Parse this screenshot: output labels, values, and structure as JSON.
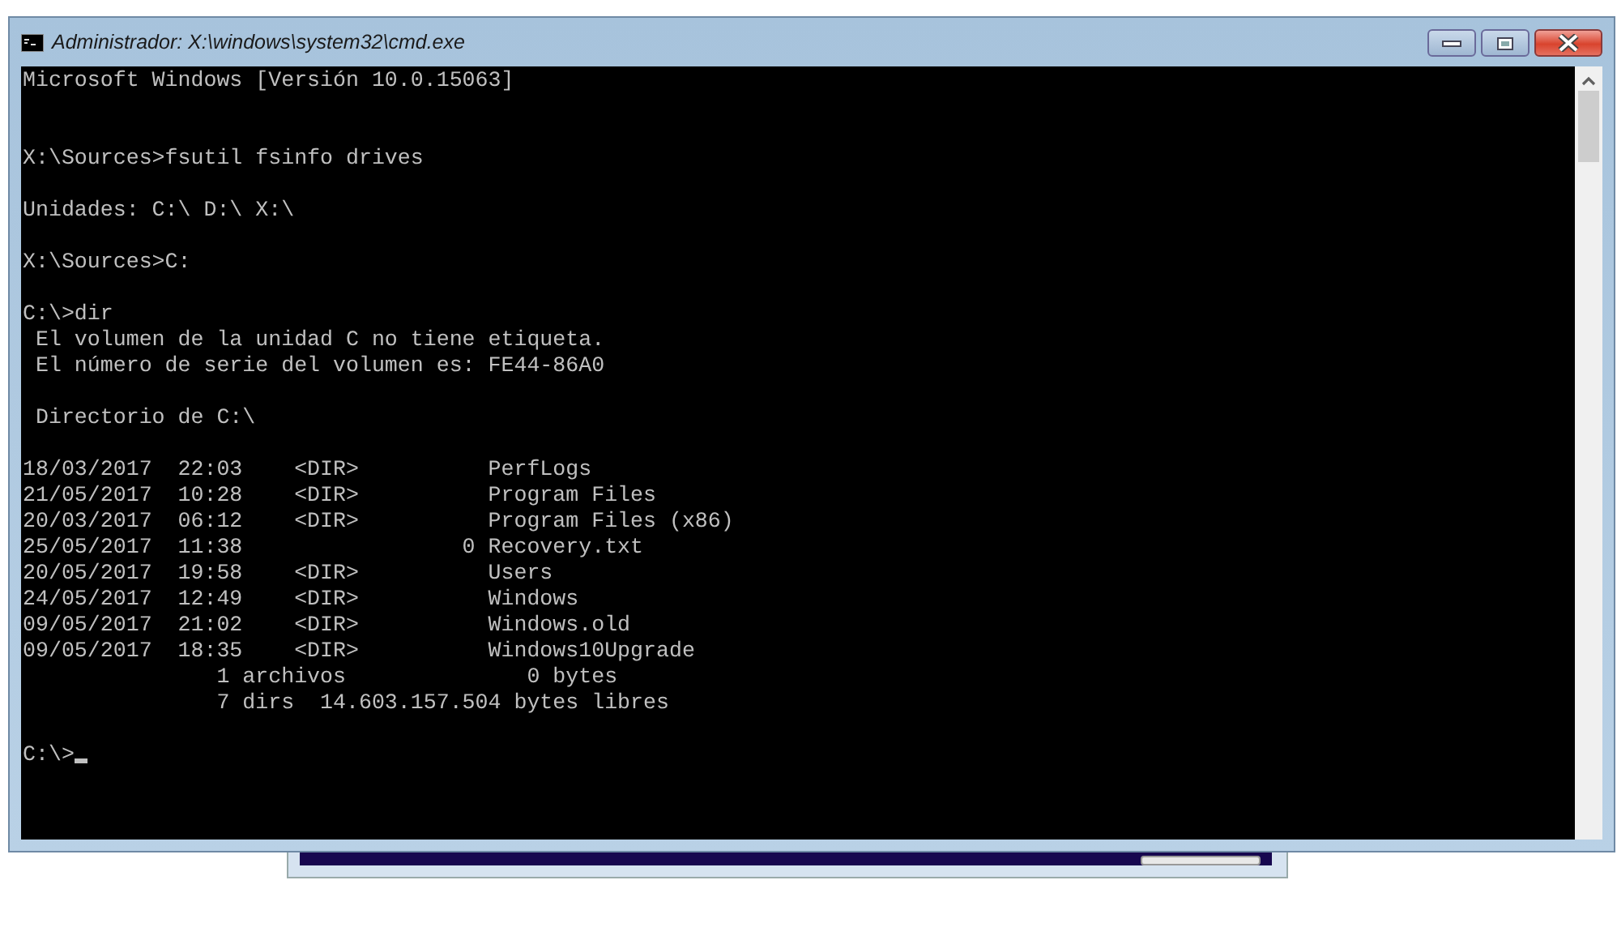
{
  "window": {
    "title": "Administrador: X:\\windows\\system32\\cmd.exe"
  },
  "console": {
    "lines": [
      {
        "kind": "text",
        "text": "Microsoft Windows [Versión 10.0.15063]"
      },
      {
        "kind": "blank"
      },
      {
        "kind": "blank"
      },
      {
        "kind": "text",
        "text": "X:\\Sources>fsutil fsinfo drives"
      },
      {
        "kind": "blank"
      },
      {
        "kind": "text",
        "text": "Unidades: C:\\ D:\\ X:\\"
      },
      {
        "kind": "blank"
      },
      {
        "kind": "text",
        "text": "X:\\Sources>C:"
      },
      {
        "kind": "blank"
      },
      {
        "kind": "text",
        "text": "C:\\>dir"
      },
      {
        "kind": "text",
        "text": " El volumen de la unidad C no tiene etiqueta."
      },
      {
        "kind": "text",
        "text": " El número de serie del volumen es: FE44-86A0"
      },
      {
        "kind": "blank"
      },
      {
        "kind": "text",
        "text": " Directorio de C:\\"
      },
      {
        "kind": "blank"
      },
      {
        "kind": "text",
        "text": "18/03/2017  22:03    <DIR>          PerfLogs"
      },
      {
        "kind": "text",
        "text": "21/05/2017  10:28    <DIR>          Program Files"
      },
      {
        "kind": "text",
        "text": "20/03/2017  06:12    <DIR>          Program Files (x86)"
      },
      {
        "kind": "text",
        "text": "25/05/2017  11:38                 0 Recovery.txt"
      },
      {
        "kind": "text",
        "text": "20/05/2017  19:58    <DIR>          Users"
      },
      {
        "kind": "text",
        "text": "24/05/2017  12:49    <DIR>          Windows"
      },
      {
        "kind": "text",
        "text": "09/05/2017  21:02    <DIR>          Windows.old"
      },
      {
        "kind": "text",
        "text": "09/05/2017  18:35    <DIR>          Windows10Upgrade"
      },
      {
        "kind": "text",
        "text": "               1 archivos              0 bytes"
      },
      {
        "kind": "text",
        "text": "               7 dirs  14.603.157.504 bytes libres"
      },
      {
        "kind": "blank"
      },
      {
        "kind": "prompt",
        "text": "C:\\>"
      }
    ]
  }
}
